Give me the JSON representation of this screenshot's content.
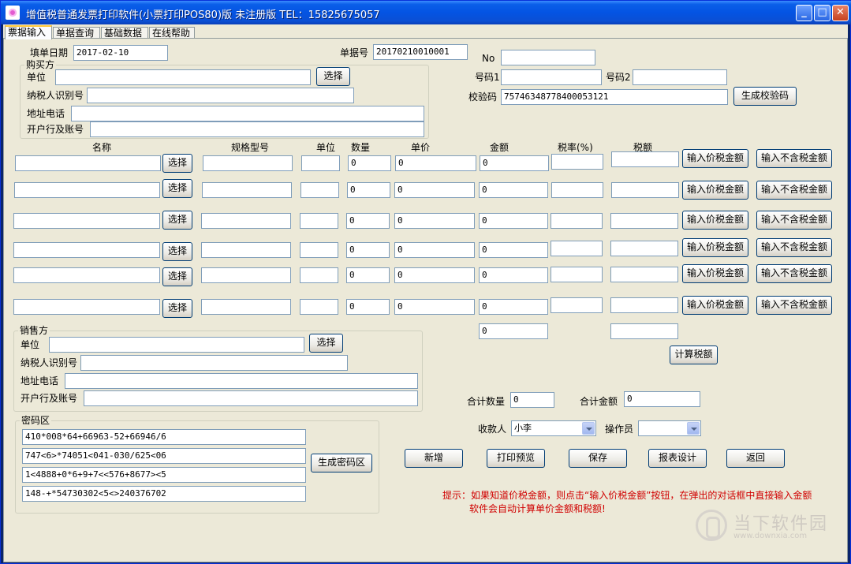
{
  "window": {
    "title": "增值税普通发票打印软件(小票打印POS80)版 未注册版  TEL：15825675057",
    "min_label": "_",
    "max_label": "□",
    "close_label": "✕"
  },
  "tabs": [
    "票据输入",
    "单据查询",
    "基础数据",
    "在线帮助"
  ],
  "header": {
    "date_label": "填单日期",
    "date_value": "2017-02-10",
    "docno_label": "单据号",
    "docno_value": "20170210010001",
    "no_label": "No",
    "no_value": "",
    "code1_label": "号码1",
    "code1_value": "",
    "code2_label": "号码2",
    "code2_value": "",
    "check_label": "校验码",
    "check_value": "75746348778400053121",
    "gen_check_button": "生成校验码"
  },
  "buyer": {
    "title": "购买方",
    "unit_label": "单位",
    "select_button": "选择",
    "taxid_label": "纳税人识别号",
    "addr_label": "地址电话",
    "bank_label": "开户行及账号"
  },
  "items": {
    "headers": [
      "名称",
      "规格型号",
      "单位",
      "数量",
      "单价",
      "金额",
      "税率(%)",
      "税额"
    ],
    "select_button": "选择",
    "input_incl_button": "输入价税金额",
    "input_excl_button": "输入不含税金额",
    "rows": [
      {
        "qty": "0",
        "price": "0",
        "amount": "0"
      },
      {
        "qty": "0",
        "price": "0",
        "amount": "0"
      },
      {
        "qty": "0",
        "price": "0",
        "amount": "0"
      },
      {
        "qty": "0",
        "price": "0",
        "amount": "0"
      },
      {
        "qty": "0",
        "price": "0",
        "amount": "0"
      },
      {
        "qty": "0",
        "price": "0",
        "amount": "0"
      }
    ],
    "amount_total": "0",
    "tax_total": "",
    "calc_tax_button": "计算税额"
  },
  "seller": {
    "title": "销售方",
    "unit_label": "单位",
    "select_button": "选择",
    "taxid_label": "纳税人识别号",
    "addr_label": "地址电话",
    "bank_label": "开户行及账号"
  },
  "cipher": {
    "title": "密码区",
    "lines": [
      "410*008*64+66963-52+66946/6",
      "747<6>*74051<041-030/625<06",
      "1<4888+0*6+9+7<<576+8677><5",
      "148-+*54730302<5<>240376702"
    ],
    "gen_button": "生成密码区"
  },
  "totals": {
    "qty_label": "合计数量",
    "qty_value": "0",
    "amount_label": "合计金额",
    "amount_value": "0"
  },
  "people": {
    "payee_label": "收款人",
    "payee_value": "小李",
    "operator_label": "操作员",
    "operator_value": ""
  },
  "actions": {
    "new": "新增",
    "print_preview": "打印预览",
    "save": "保存",
    "report_design": "报表设计",
    "back": "返回"
  },
  "hint": {
    "line1": "提示：如果知道价税金额，则点击“输入价税金额”按钮，在弹出的对话框中直接输入金额",
    "line2": "软件会自动计算单价金额和税额!"
  },
  "watermark": {
    "name": "当下软件园",
    "url": "www.downxia.com"
  }
}
